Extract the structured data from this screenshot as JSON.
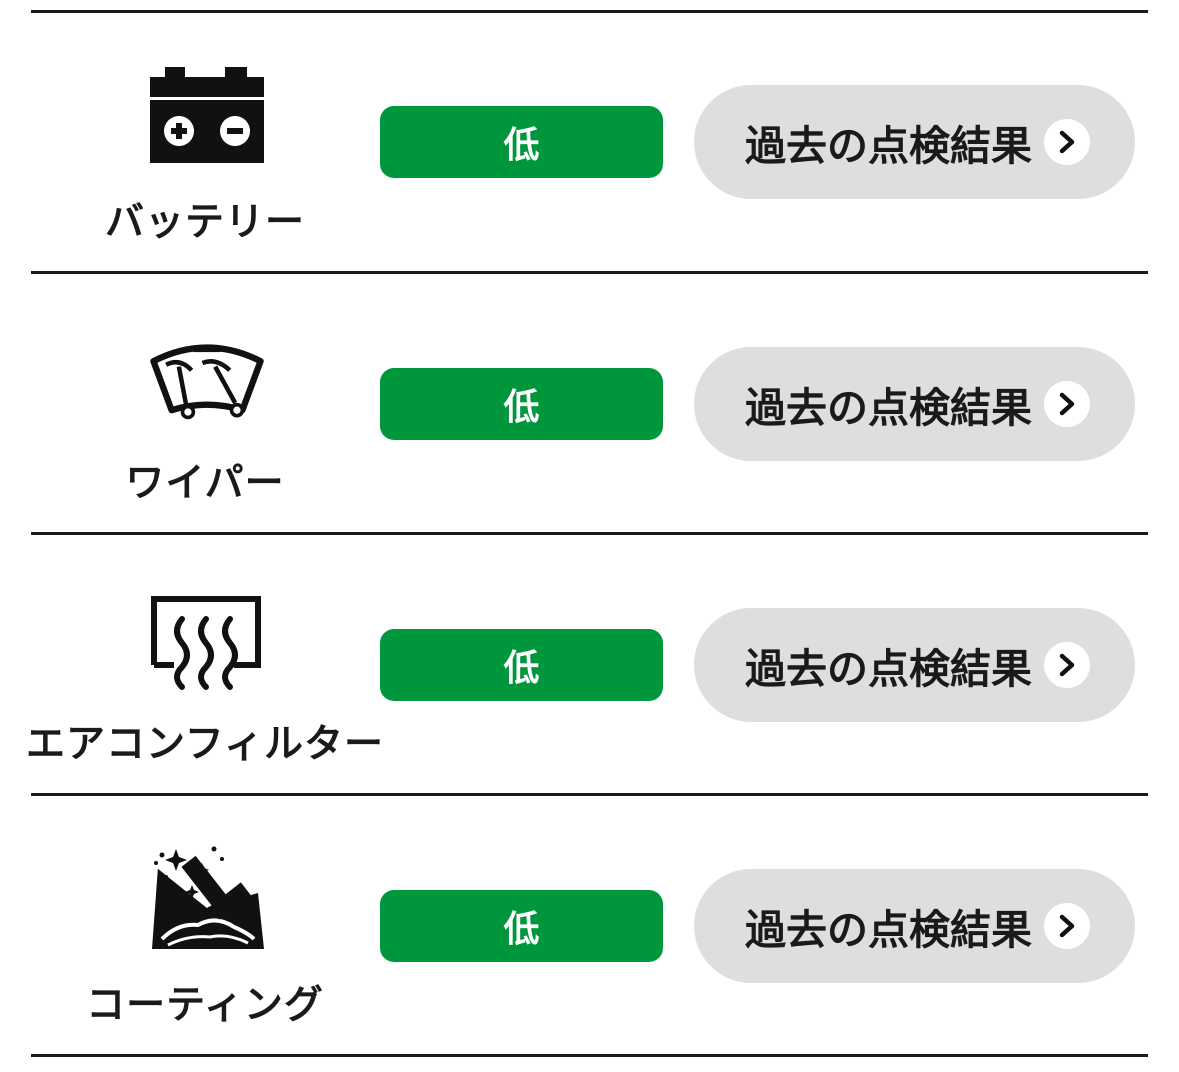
{
  "items": [
    {
      "label": "バッテリー",
      "icon": "battery-icon",
      "level": "低",
      "history_label": "過去の点検結果",
      "button_icon": "chevron-right-icon"
    },
    {
      "label": "ワイパー",
      "icon": "wiper-icon",
      "level": "低",
      "history_label": "過去の点検結果",
      "button_icon": "chevron-right-icon"
    },
    {
      "label": "エアコンフィルター",
      "icon": "aircon-filter-icon",
      "level": "低",
      "history_label": "過去の点検結果",
      "button_icon": "chevron-right-icon"
    },
    {
      "label": "コーティング",
      "icon": "coating-icon",
      "level": "低",
      "history_label": "過去の点検結果",
      "button_icon": "chevron-right-icon"
    }
  ],
  "colors": {
    "level_low": "#00963c",
    "button_bg": "#dedede",
    "divider": "#1a1a1a",
    "text": "#1a1a1a"
  }
}
